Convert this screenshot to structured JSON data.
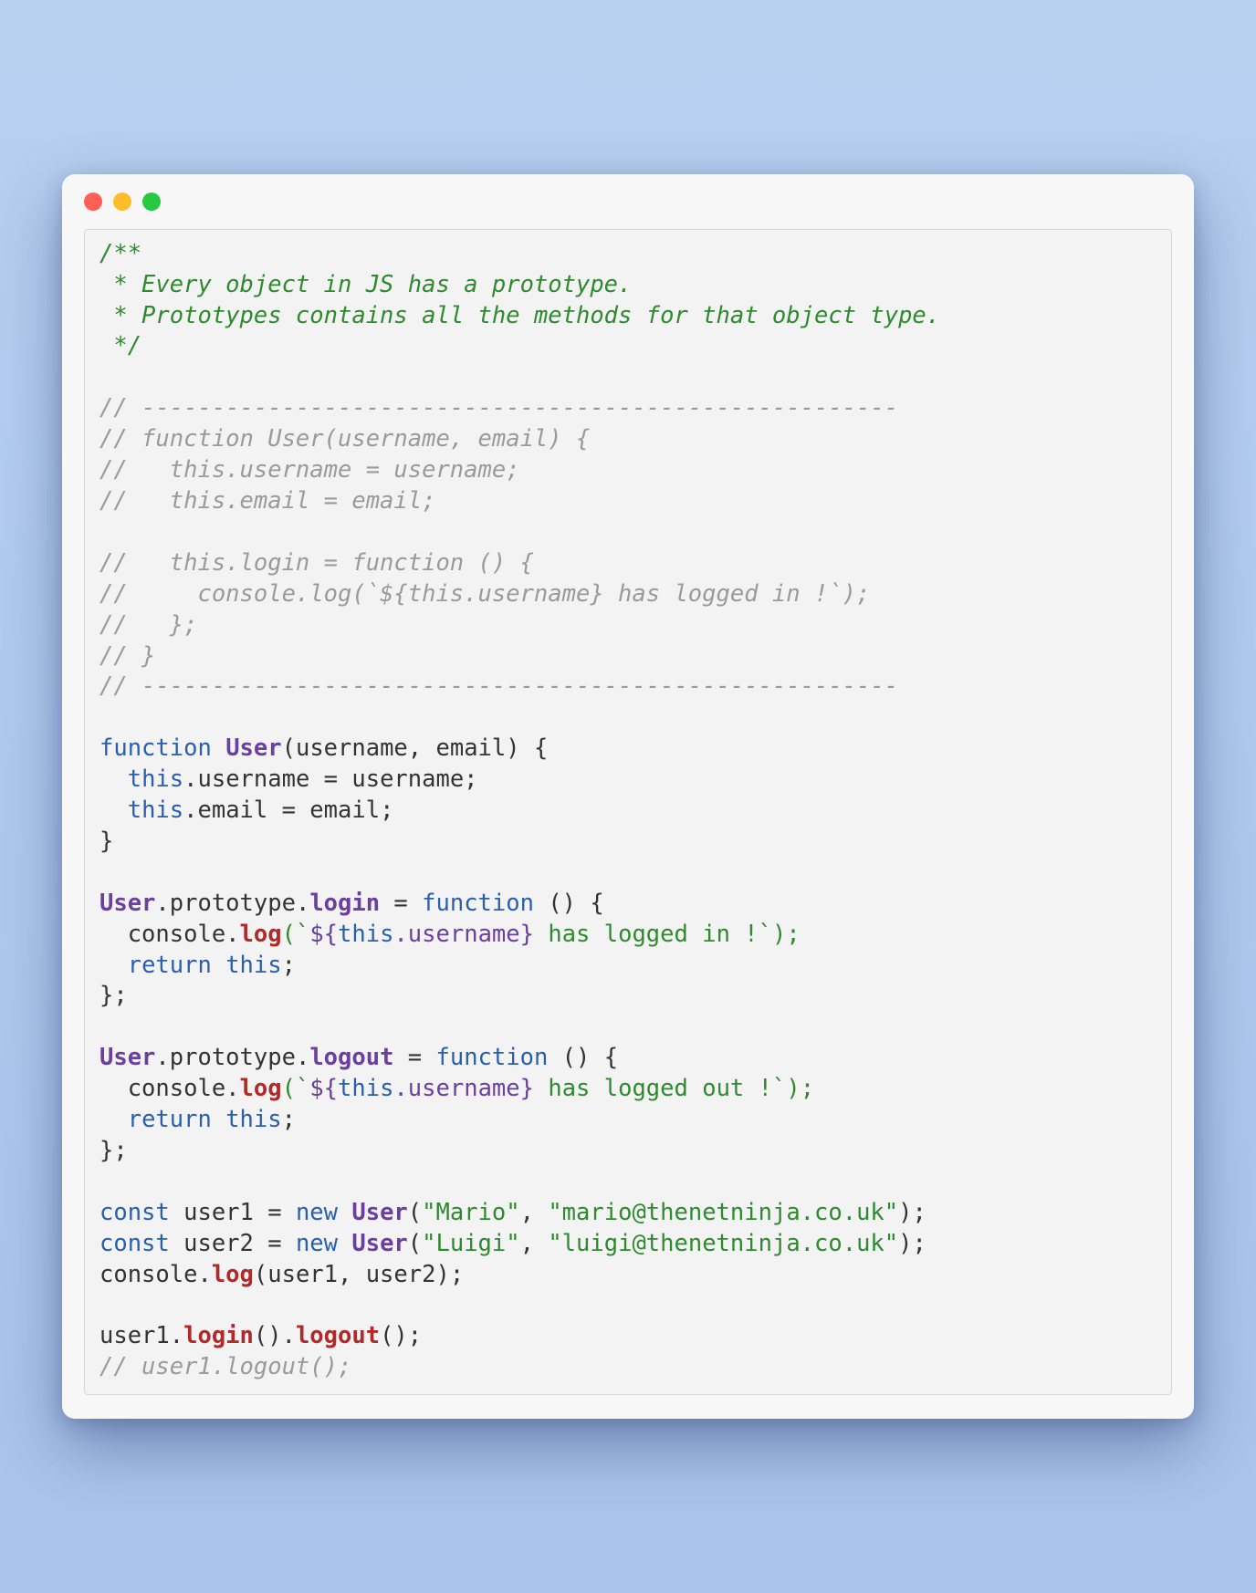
{
  "window": {
    "dots": {
      "red": "#ff5f56",
      "yellow": "#ffbd2e",
      "green": "#27c93f"
    }
  },
  "code": {
    "doc1": "/**",
    "doc2": " * Every object in JS has a prototype.",
    "doc3": " * Prototypes contains all the methods for that object type.",
    "doc4": " */",
    "blank": "",
    "sep": "// ------------------------------------------------------",
    "cf1": "// function User(username, email) {",
    "cf2": "//   this.username = username;",
    "cf3": "//   this.email = email;",
    "cf4": "//   this.login = function () {",
    "cf5": "//     console.log(`${this.username} has logged in !`);",
    "cf6": "//   };",
    "cf7": "// }",
    "kw_function": "function",
    "kw_return": "return",
    "kw_this": "this",
    "kw_const": "const",
    "kw_new": "new",
    "UserName": "User",
    "fn_params": "(username, email) {",
    "body_u": ".username = username;",
    "body_e": ".email = email;",
    "close_brace": "}",
    "proto": ".prototype.",
    "login": "login",
    "logout": "logout",
    "fn_expr_open": " = ",
    "anon_fn_open": " () {",
    "console": "  console.",
    "log": "log",
    "tick_open": "(`",
    "expr_open": "${",
    "expr_mid": ".username",
    "expr_close": "}",
    "msg_in": " has logged in !",
    "msg_out": " has logged out !",
    "tick_close": "`);",
    "ret_this_line": "  ",
    "ret_semi": ";",
    "end_fn": "};",
    "u1": " user1 = ",
    "u2": " user2 = ",
    "args1": "(",
    "s_Mario": "\"Mario\"",
    "comma_sp": ", ",
    "s_mario_email": "\"mario@thenetninja.co.uk\"",
    "s_Luigi": "\"Luigi\"",
    "s_luigi_email": "\"luigi@thenetninja.co.uk\"",
    "args_close": ");",
    "clogprefix": "console.",
    "clog_args": "(user1, user2);",
    "chain_pre": "user1.",
    "chain_mid": "().",
    "chain_end": "();",
    "last_comment": "// user1.logout();"
  }
}
